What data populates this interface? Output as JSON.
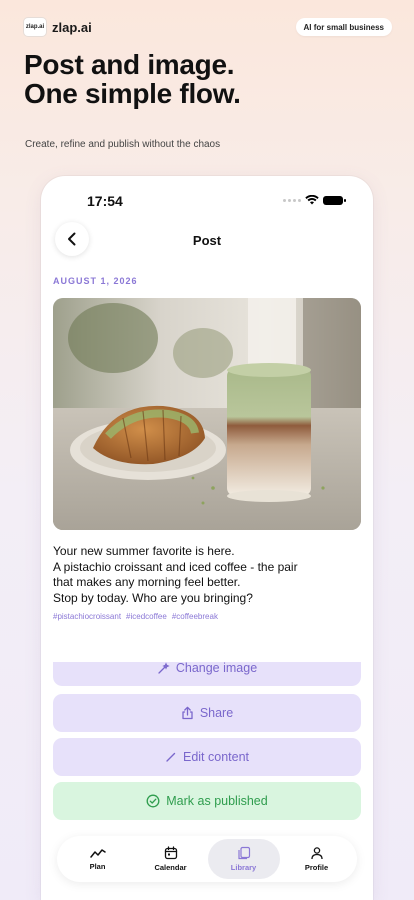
{
  "brand": {
    "logo_text": "zlap.ai",
    "name": "zlap.ai"
  },
  "badge": "AI for small business",
  "hero": {
    "title_line1": "Post and image.",
    "title_line2": "One simple flow.",
    "subtitle": "Create, refine and publish without the chaos"
  },
  "phone": {
    "status_time": "17:54",
    "screen_title": "Post",
    "date": "AUGUST 1, 2026",
    "caption": [
      "Your new summer favorite is here.",
      "A pistachio croissant and iced coffee - the pair",
      "that makes any morning feel better.",
      "Stop by today. Who are you bringing?"
    ],
    "hashtags": [
      "#pistachiocroissant",
      "#icedcoffee",
      "#coffeebreak"
    ],
    "actions": {
      "change_image": "Change image",
      "share": "Share",
      "edit_content": "Edit content",
      "mark_published": "Mark as published"
    },
    "tabs": [
      {
        "label": "Plan",
        "icon": "chart-icon"
      },
      {
        "label": "Calendar",
        "icon": "calendar-icon"
      },
      {
        "label": "Library",
        "icon": "library-icon",
        "active": true
      },
      {
        "label": "Profile",
        "icon": "profile-icon"
      }
    ]
  },
  "colors": {
    "accent": "#8b78d6",
    "action_purple": "#e7e1fa",
    "action_green": "#d9f5df",
    "green_text": "#2f9d4e"
  }
}
